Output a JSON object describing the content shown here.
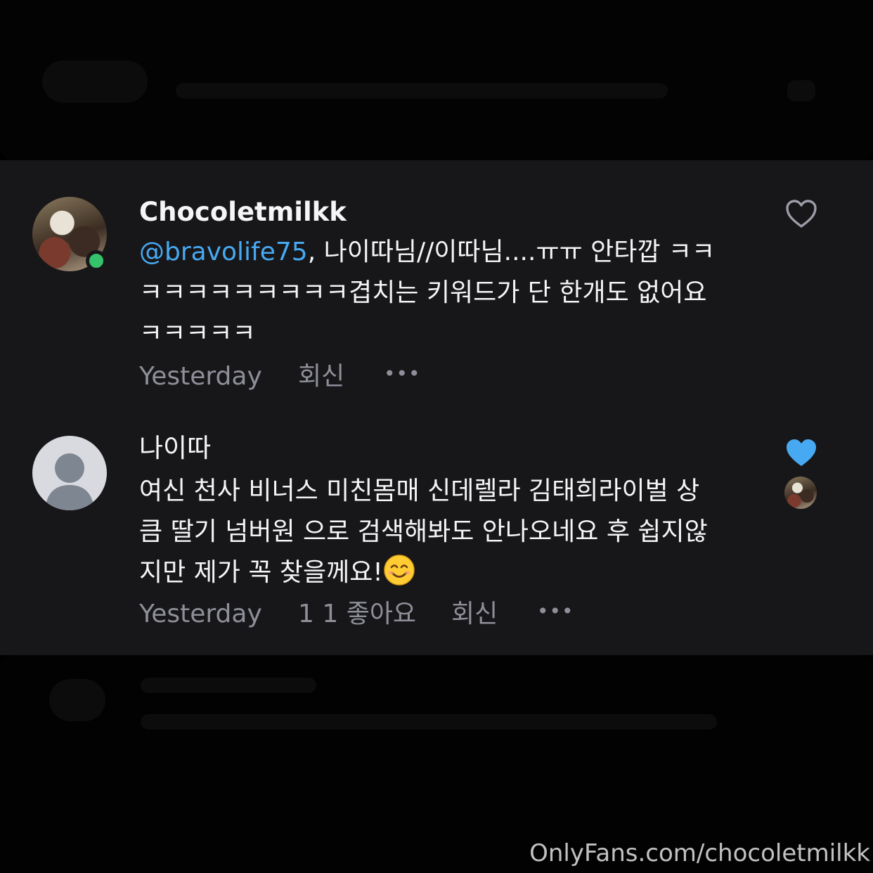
{
  "comments": [
    {
      "username": "Chocoletmilkk",
      "mention": "@bravolife75",
      "text_line1": ", 나이따님//이따님....ㅠㅠ 안타깝 ㅋㅋ",
      "text_line2": "ㅋㅋㅋㅋㅋㅋㅋㅋㅋ겹치는 키워드가 단 한개도 없어요",
      "text_line3": "ㅋㅋㅋㅋㅋ",
      "time": "Yesterday",
      "reply_label": "회신",
      "more_label": "•••",
      "liked": false,
      "online": true,
      "avatar": "photo-avatar"
    },
    {
      "username": "나이따",
      "text_line1": "여신 천사 비너스 미친몸매 신데렐라 김태희라이벌 상",
      "text_line2": "큼 딸기 넘버원 으로 검색해봐도 안나오네요 후 쉽지않",
      "text_line3": "지만 제가 꼭 찾을께요!",
      "emoji": "smiling-face-emoji",
      "time": "Yesterday",
      "likes_label": "1 1 좋아요",
      "reply_label": "회신",
      "more_label": "•••",
      "liked": true,
      "liked_by_author": true,
      "avatar": "default-avatar"
    }
  ],
  "watermark": "OnlyFans.com/chocoletmilkk",
  "colors": {
    "background": "#17171a",
    "mention": "#47a9f1",
    "like_active": "#47a9f1",
    "meta": "#8e8f98",
    "online": "#35c46b"
  }
}
